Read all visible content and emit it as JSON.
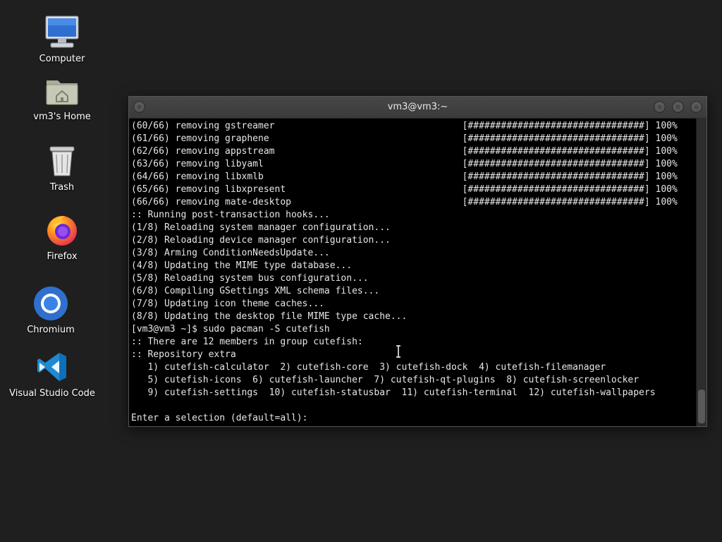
{
  "desktop": {
    "icons": [
      {
        "label": "Computer",
        "icon": "computer-icon"
      },
      {
        "label": "vm3's Home",
        "icon": "home-folder-icon"
      },
      {
        "label": "Trash",
        "icon": "trash-icon"
      },
      {
        "label": "Firefox",
        "icon": "firefox-icon"
      },
      {
        "label": "Chromium",
        "icon": "chromium-icon"
      },
      {
        "label": "Visual Studio Code",
        "icon": "vscode-icon"
      }
    ]
  },
  "terminal": {
    "title": "vm3@vm3:~",
    "lines": [
      "(60/66) removing gstreamer                                  [################################] 100%",
      "(61/66) removing graphene                                   [################################] 100%",
      "(62/66) removing appstream                                  [################################] 100%",
      "(63/66) removing libyaml                                    [################################] 100%",
      "(64/66) removing libxmlb                                    [################################] 100%",
      "(65/66) removing libxpresent                                [################################] 100%",
      "(66/66) removing mate-desktop                               [################################] 100%",
      ":: Running post-transaction hooks...",
      "(1/8) Reloading system manager configuration...",
      "(2/8) Reloading device manager configuration...",
      "(3/8) Arming ConditionNeedsUpdate...",
      "(4/8) Updating the MIME type database...",
      "(5/8) Reloading system bus configuration...",
      "(6/8) Compiling GSettings XML schema files...",
      "(7/8) Updating icon theme caches...",
      "(8/8) Updating the desktop file MIME type cache...",
      "[vm3@vm3 ~]$ sudo pacman -S cutefish",
      ":: There are 12 members in group cutefish:",
      ":: Repository extra",
      "   1) cutefish-calculator  2) cutefish-core  3) cutefish-dock  4) cutefish-filemanager",
      "   5) cutefish-icons  6) cutefish-launcher  7) cutefish-qt-plugins  8) cutefish-screenlocker",
      "   9) cutefish-settings  10) cutefish-statusbar  11) cutefish-terminal  12) cutefish-wallpapers",
      "",
      "Enter a selection (default=all): "
    ]
  }
}
